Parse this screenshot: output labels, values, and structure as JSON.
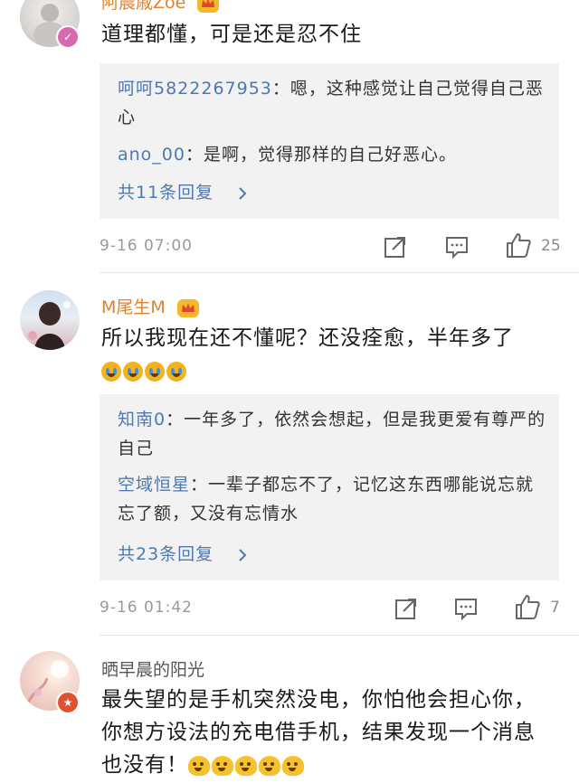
{
  "comments": [
    {
      "username": "阿晨戚Zoe",
      "text": "道理都懂，可是还是忍不住",
      "replies": [
        {
          "name": "呵呵5822267953",
          "text": "：嗯，这种感觉让自己觉得自己恶心"
        },
        {
          "name": "ano_00",
          "text": "：是啊，觉得那样的自己好恶心。"
        }
      ],
      "more": "共11条回复",
      "time": "9-16 07:00",
      "likes": "25"
    },
    {
      "username": "M尾生M",
      "text": "所以我现在还不懂呢？还没痊愈，半年多了",
      "replies": [
        {
          "name": "知南0",
          "text": "：一年多了，依然会想起，但是我更爱有尊严的自己"
        },
        {
          "name": "空域恒星",
          "text": "：一辈子都忘不了，记忆这东西哪能说忘就忘了额，又没有忘情水"
        }
      ],
      "more": "共23条回复",
      "time": "9-16 01:42",
      "likes": "7"
    },
    {
      "username": "晒早晨的阳光",
      "text": "最失望的是手机突然没电，你怕他会担心你，你想方设法的充电借手机，结果发现一个消息也没有！"
    }
  ],
  "icons": {
    "share": "share-icon",
    "comment": "comment-icon",
    "like": "like-icon",
    "chevron": "chevron-right-icon",
    "crown": "vip-crown-icon"
  },
  "colors": {
    "accent_link": "#4e79b0",
    "username_orange": "#e0822b",
    "reply_bg": "#f2f2f2",
    "meta_gray": "#9a9a9a"
  }
}
